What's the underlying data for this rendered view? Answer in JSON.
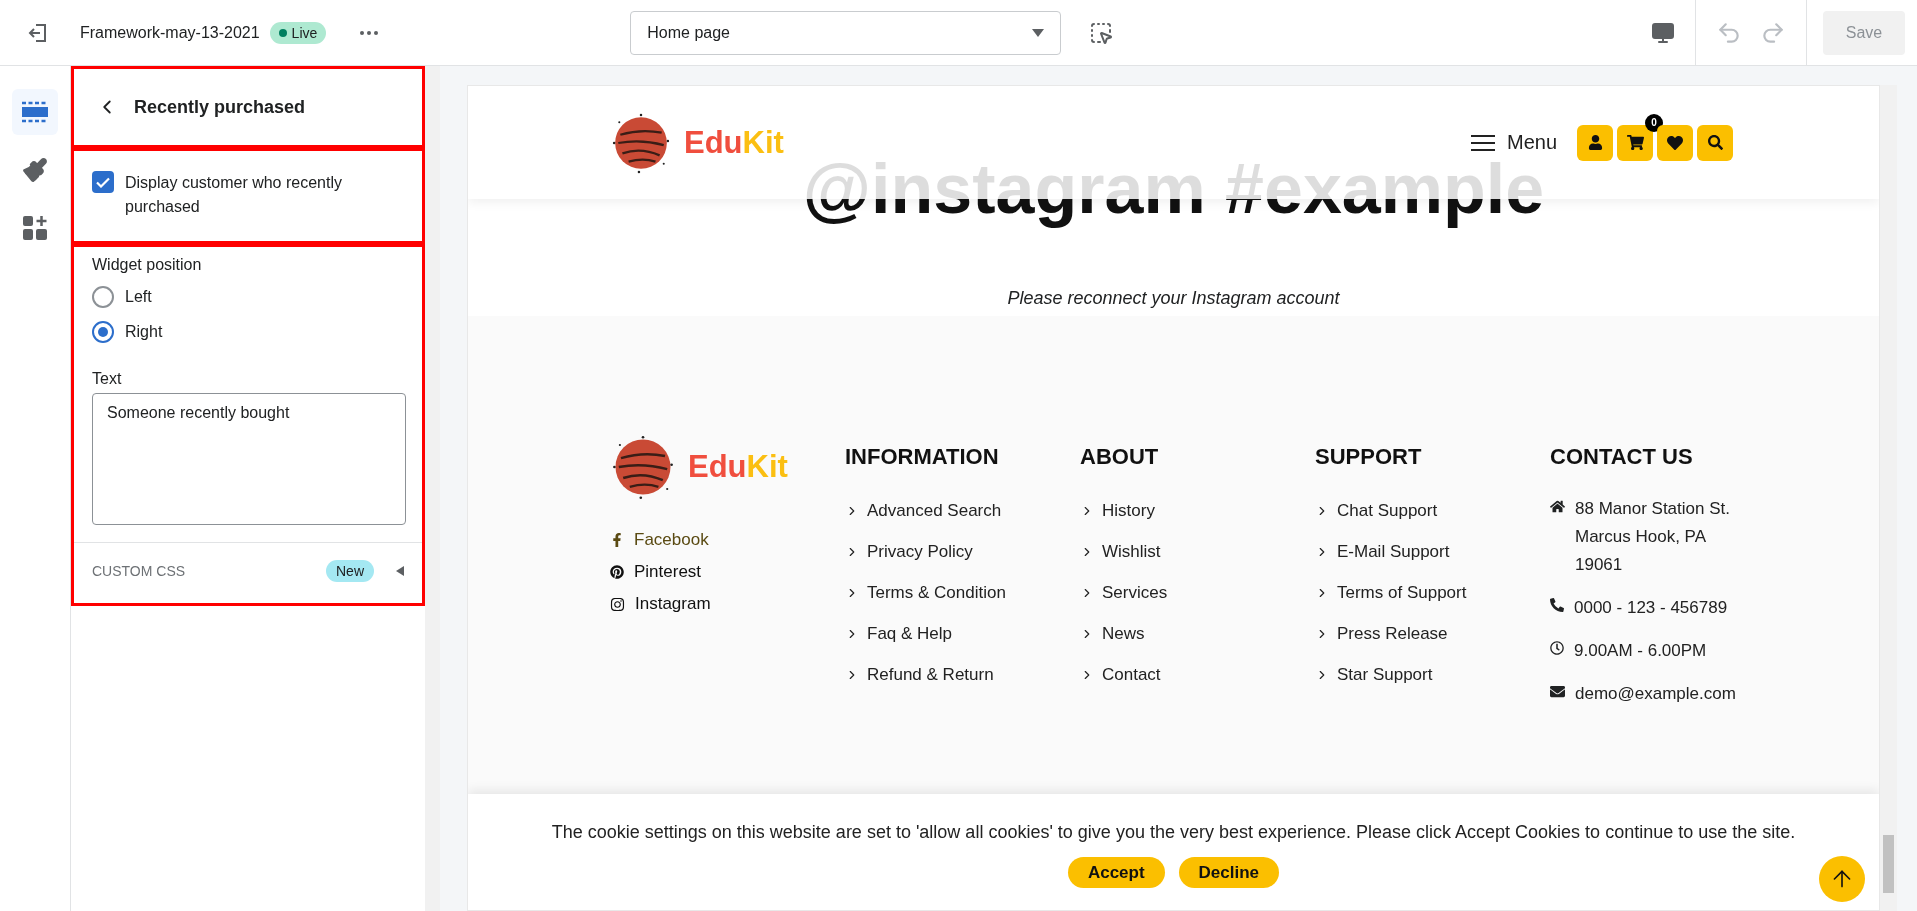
{
  "toolbar": {
    "theme_name": "Framework-may-13-2021",
    "status": "Live",
    "page_select": "Home page",
    "save": {
      "label": "Save",
      "disabled": true
    }
  },
  "rail": [
    {
      "kind": "sections",
      "selected": true
    },
    {
      "kind": "theme",
      "selected": false
    },
    {
      "kind": "apps",
      "selected": false
    }
  ],
  "panel": {
    "header": {
      "title": "Recently purchased",
      "highlighted": true
    },
    "checkbox": {
      "label": "Display customer who recently purchased",
      "checked": true,
      "highlighted": true
    },
    "options": {
      "highlighted": true,
      "position_label": "Widget position",
      "positions": [
        {
          "label": "Left",
          "selected": false
        },
        {
          "label": "Right",
          "selected": true
        }
      ],
      "text_label": "Text",
      "text_value": "Someone recently bought",
      "custom_css_label": "CUSTOM CSS",
      "custom_css_badge": "New"
    }
  },
  "preview": {
    "header": {
      "logo": [
        "Edu",
        "Kit"
      ],
      "menu_label": "Menu",
      "cart_count": "0"
    },
    "instagram": {
      "heading": "@instagram #example",
      "message": "Please reconnect your Instagram account"
    },
    "footer": {
      "logo": [
        "Edu",
        "Kit"
      ],
      "social": [
        {
          "kind": "facebook",
          "label": "Facebook",
          "hovered": true
        },
        {
          "kind": "pinterest",
          "label": "Pinterest",
          "hovered": false
        },
        {
          "kind": "instagram",
          "label": "Instagram",
          "hovered": false
        }
      ],
      "columns": [
        {
          "title": "INFORMATION",
          "links": [
            "Advanced Search",
            "Privacy Policy",
            "Terms & Condition",
            "Faq & Help",
            "Refund & Return"
          ]
        },
        {
          "title": "ABOUT",
          "links": [
            "History",
            "Wishlist",
            "Services",
            "News",
            "Contact"
          ]
        },
        {
          "title": "SUPPORT",
          "links": [
            "Chat Support",
            "E-Mail Support",
            "Terms of Support",
            "Press Release",
            "Star Support"
          ]
        }
      ],
      "contact": {
        "title": "CONTACT US",
        "items": [
          {
            "kind": "address",
            "text": "88 Manor Station St. Marcus Hook, PA 19061"
          },
          {
            "kind": "phone",
            "text": "0000 - 123 - 456789"
          },
          {
            "kind": "hours",
            "text": "9.00AM - 6.00PM"
          },
          {
            "kind": "email",
            "text": "demo@example.com"
          }
        ]
      }
    },
    "cookie": {
      "text": "The cookie settings on this website are set to 'allow all cookies' to give you the very best experience. Please click Accept Cookies to continue to use the site.",
      "buttons": [
        "Accept",
        "Decline"
      ]
    }
  }
}
